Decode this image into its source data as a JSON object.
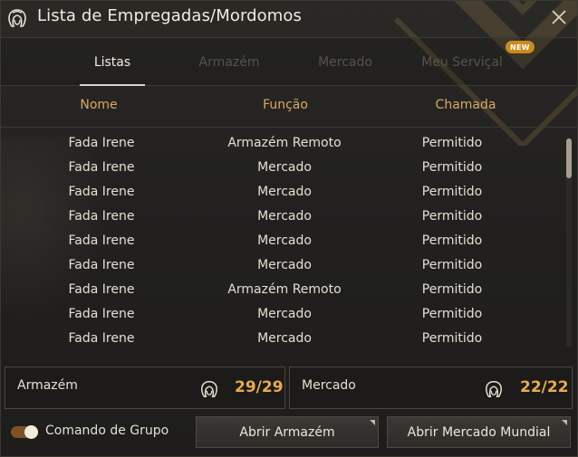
{
  "window": {
    "title": "Lista de Empregadas/Mordomos",
    "icon": "maid-head-icon",
    "close_icon": "close-icon"
  },
  "tabs": [
    {
      "label": "Listas",
      "active": true
    },
    {
      "label": "Armazém",
      "active": false
    },
    {
      "label": "Mercado",
      "active": false
    },
    {
      "label": "Meu Serviçal",
      "active": false,
      "badge": "NEW"
    }
  ],
  "columns": {
    "name": "Nome",
    "function": "Função",
    "call": "Chamada"
  },
  "rows": [
    {
      "name": "Fada Irene",
      "function": "Armazém Remoto",
      "call": "Permitido"
    },
    {
      "name": "Fada Irene",
      "function": "Mercado",
      "call": "Permitido"
    },
    {
      "name": "Fada Irene",
      "function": "Mercado",
      "call": "Permitido"
    },
    {
      "name": "Fada Irene",
      "function": "Mercado",
      "call": "Permitido"
    },
    {
      "name": "Fada Irene",
      "function": "Mercado",
      "call": "Permitido"
    },
    {
      "name": "Fada Irene",
      "function": "Mercado",
      "call": "Permitido"
    },
    {
      "name": "Fada Irene",
      "function": "Armazém Remoto",
      "call": "Permitido"
    },
    {
      "name": "Fada Irene",
      "function": "Mercado",
      "call": "Permitido"
    },
    {
      "name": "Fada Irene",
      "function": "Mercado",
      "call": "Permitido"
    }
  ],
  "summary": {
    "warehouse": {
      "label": "Armazém",
      "count": "29/29",
      "icon": "maid-head-icon"
    },
    "market": {
      "label": "Mercado",
      "count": "22/22",
      "icon": "maid-head-icon"
    }
  },
  "footer": {
    "group_command_label": "Comando de Grupo",
    "group_command_on": true,
    "open_warehouse_label": "Abrir Armazém",
    "open_market_label": "Abrir Mercado Mundial"
  },
  "colors": {
    "accent": "#d9a864",
    "count": "#e8ac4c",
    "badge": "#c98b1e"
  }
}
